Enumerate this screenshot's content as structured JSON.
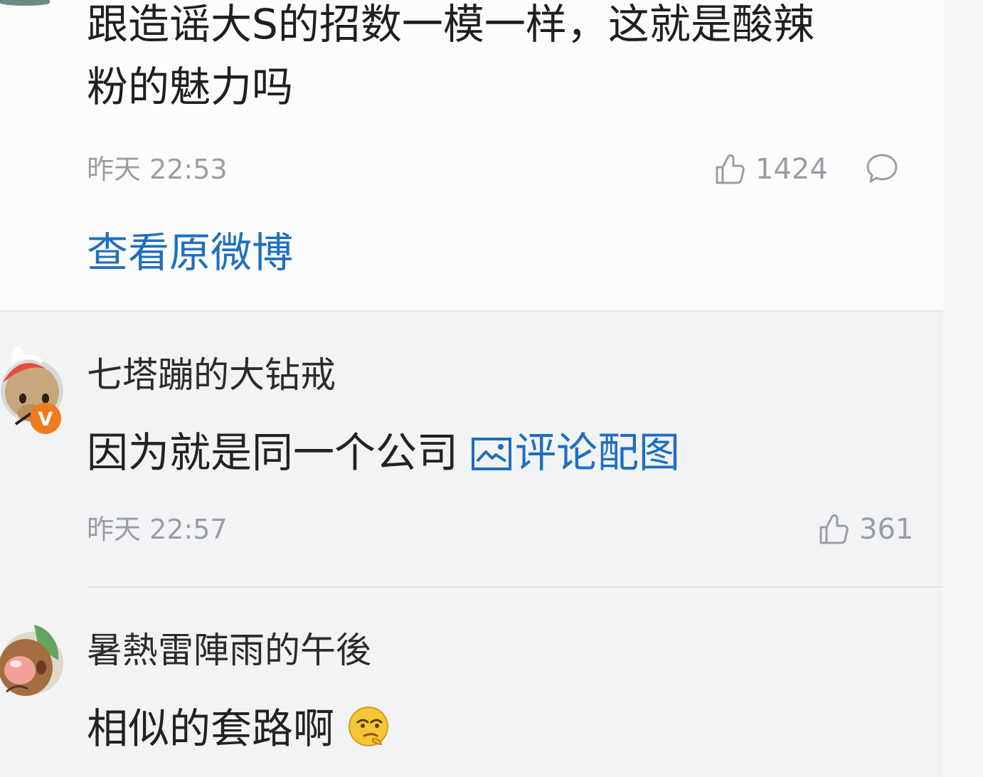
{
  "post": {
    "text_line1": "跟造谣大S的招数一模一样，这就是酸辣",
    "text_line2": "粉的魅力吗",
    "time": "昨天 22:53",
    "likes": "1424",
    "view_original": "查看原微博"
  },
  "comments": [
    {
      "name": "七塔蹦的大钻戒",
      "text": "因为就是同一个公司",
      "image_link": "评论配图",
      "time": "昨天 22:57",
      "likes": "361",
      "badge": "V"
    },
    {
      "name": "暑熱雷陣雨的午後",
      "text": "相似的套路啊"
    }
  ],
  "colors": {
    "link": "#1f6fbf",
    "muted": "#9a9da3",
    "background": "#f2f3f5",
    "card": "#fcfcfd",
    "badge": "#f07a1d"
  },
  "icons": {
    "like": "thumbs-up-icon",
    "comment": "comment-bubble-icon",
    "image": "image-icon",
    "emoji": "thinking-face-emoji"
  }
}
